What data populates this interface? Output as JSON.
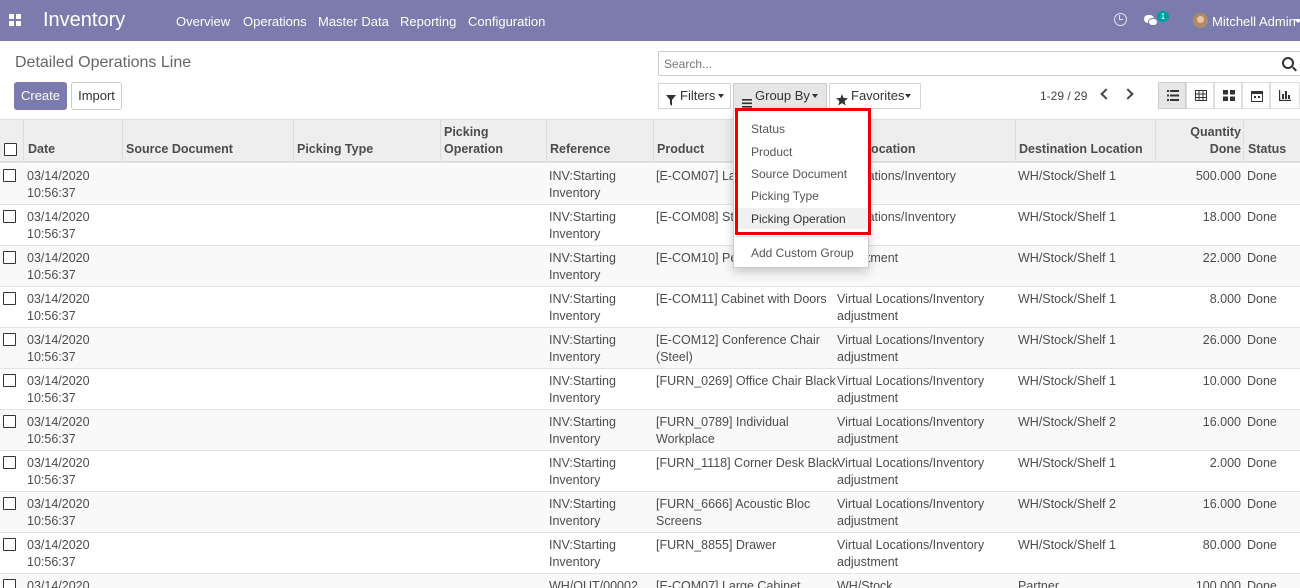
{
  "navbar": {
    "app_name": "Inventory",
    "menus": [
      "Overview",
      "Operations",
      "Master Data",
      "Reporting",
      "Configuration"
    ],
    "chat_badge": "1",
    "user_name": "Mitchell Admin",
    "icons": [
      "apps-grid-icon",
      "clock-icon",
      "chat-icon",
      "avatar"
    ]
  },
  "page": {
    "title": "Detailed Operations Line",
    "create_label": "Create",
    "import_label": "Import"
  },
  "search": {
    "placeholder": "Search...",
    "filters_label": "Filters",
    "group_by_label": "Group By",
    "favorites_label": "Favorites"
  },
  "pager": {
    "value": "1-29 / 29"
  },
  "group_by_menu": {
    "items": [
      "Status",
      "Product",
      "Source Document",
      "Picking Type",
      "Picking Operation"
    ],
    "custom_label": "Add Custom Group",
    "hovered": "Picking Operation"
  },
  "table": {
    "headers": {
      "date": "Date",
      "source_document": "Source Document",
      "picking_type": "Picking Type",
      "picking_operation": [
        "Picking",
        "Operation"
      ],
      "reference": "Reference",
      "product": "Product",
      "source_location": "e Location",
      "destination_location": "Destination Location",
      "quantity_done": [
        "Quantity",
        "Done"
      ],
      "status": "Status"
    },
    "rows": [
      {
        "date": "03/14/2020",
        "time": "10:56:37",
        "ref1": "INV:Starting",
        "ref2": "Inventory",
        "prod1": "[E-COM07] La",
        "prod2": "",
        "src1": "e Locations/Inventory",
        "src2": "ment",
        "dest": "WH/Stock/Shelf 1",
        "qty": "500.000",
        "status": "Done"
      },
      {
        "date": "03/14/2020",
        "time": "10:56:37",
        "ref1": "INV:Starting",
        "ref2": "Inventory",
        "prod1": "[E-COM08] St",
        "prod2": "",
        "src1": "e Locations/Inventory",
        "src2": "ment",
        "dest": "WH/Stock/Shelf 1",
        "qty": "18.000",
        "status": "Done"
      },
      {
        "date": "03/14/2020",
        "time": "10:56:37",
        "ref1": "INV:Starting",
        "ref2": "Inventory",
        "prod1": "[E-COM10] Pe",
        "prod2": "",
        "src1": "",
        "src2": "adjustment",
        "dest": "WH/Stock/Shelf 1",
        "qty": "22.000",
        "status": "Done"
      },
      {
        "date": "03/14/2020",
        "time": "10:56:37",
        "ref1": "INV:Starting",
        "ref2": "Inventory",
        "prod1": "[E-COM11] Cabinet with Doors",
        "prod2": "",
        "src1": "Virtual Locations/Inventory",
        "src2": "adjustment",
        "dest": "WH/Stock/Shelf 1",
        "qty": "8.000",
        "status": "Done"
      },
      {
        "date": "03/14/2020",
        "time": "10:56:37",
        "ref1": "INV:Starting",
        "ref2": "Inventory",
        "prod1": "[E-COM12] Conference Chair",
        "prod2": "(Steel)",
        "src1": "Virtual Locations/Inventory",
        "src2": "adjustment",
        "dest": "WH/Stock/Shelf 1",
        "qty": "26.000",
        "status": "Done"
      },
      {
        "date": "03/14/2020",
        "time": "10:56:37",
        "ref1": "INV:Starting",
        "ref2": "Inventory",
        "prod1": "[FURN_0269] Office Chair Black",
        "prod2": "",
        "src1": "Virtual Locations/Inventory",
        "src2": "adjustment",
        "dest": "WH/Stock/Shelf 1",
        "qty": "10.000",
        "status": "Done"
      },
      {
        "date": "03/14/2020",
        "time": "10:56:37",
        "ref1": "INV:Starting",
        "ref2": "Inventory",
        "prod1": "[FURN_0789] Individual",
        "prod2": "Workplace",
        "src1": "Virtual Locations/Inventory",
        "src2": "adjustment",
        "dest": "WH/Stock/Shelf 2",
        "qty": "16.000",
        "status": "Done"
      },
      {
        "date": "03/14/2020",
        "time": "10:56:37",
        "ref1": "INV:Starting",
        "ref2": "Inventory",
        "prod1": "[FURN_1118] Corner Desk Black",
        "prod2": "",
        "src1": "Virtual Locations/Inventory",
        "src2": "adjustment",
        "dest": "WH/Stock/Shelf 1",
        "qty": "2.000",
        "status": "Done"
      },
      {
        "date": "03/14/2020",
        "time": "10:56:37",
        "ref1": "INV:Starting",
        "ref2": "Inventory",
        "prod1": "[FURN_6666] Acoustic Bloc",
        "prod2": "Screens",
        "src1": "Virtual Locations/Inventory",
        "src2": "adjustment",
        "dest": "WH/Stock/Shelf 2",
        "qty": "16.000",
        "status": "Done"
      },
      {
        "date": "03/14/2020",
        "time": "10:56:37",
        "ref1": "INV:Starting",
        "ref2": "Inventory",
        "prod1": "[FURN_8855] Drawer",
        "prod2": "",
        "src1": "Virtual Locations/Inventory",
        "src2": "adjustment",
        "dest": "WH/Stock/Shelf 1",
        "qty": "80.000",
        "status": "Done"
      },
      {
        "date": "03/14/2020",
        "time": "",
        "ref1": "WH/OUT/00002",
        "ref2": "",
        "prod1": "[E-COM07] Large Cabinet",
        "prod2": "",
        "src1": "WH/Stock",
        "src2": "",
        "dest": "Partner",
        "qty": "100.000",
        "status": "Done"
      }
    ]
  }
}
